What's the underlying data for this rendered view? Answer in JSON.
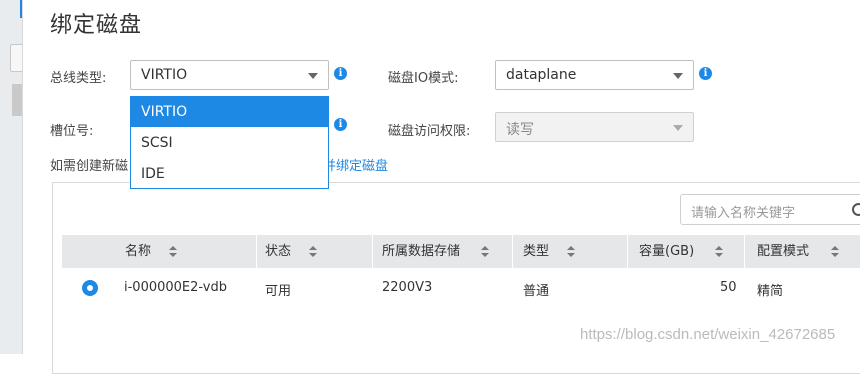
{
  "dialog": {
    "title": "绑定磁盘"
  },
  "form": {
    "bus_type": {
      "label": "总线类型:",
      "value": "VIRTIO"
    },
    "disk_io_mode": {
      "label": "磁盘IO模式:",
      "value": "dataplane"
    },
    "slot": {
      "label": "槽位号:"
    },
    "disk_access": {
      "label": "磁盘访问权限:",
      "value": "读写"
    },
    "note_prefix": "如需创建新磁",
    "note_link": "建并绑定磁盘"
  },
  "dropdown": {
    "options": [
      "VIRTIO",
      "SCSI",
      "IDE"
    ],
    "highlighted": "VIRTIO"
  },
  "search": {
    "placeholder": "请输入名称关键字"
  },
  "table": {
    "columns": [
      "名称",
      "状态",
      "所属数据存储",
      "类型",
      "容量(GB)",
      "配置模式"
    ],
    "rows": [
      {
        "name": "i-000000E2-vdb",
        "status": "可用",
        "datastore": "2200V3",
        "type": "普通",
        "capacity": "50",
        "mode": "精简"
      }
    ]
  },
  "watermark": "https://blog.csdn.net/weixin_42672685",
  "colors": {
    "accent": "#1e88e5",
    "header_bg": "#e6e7e9"
  }
}
